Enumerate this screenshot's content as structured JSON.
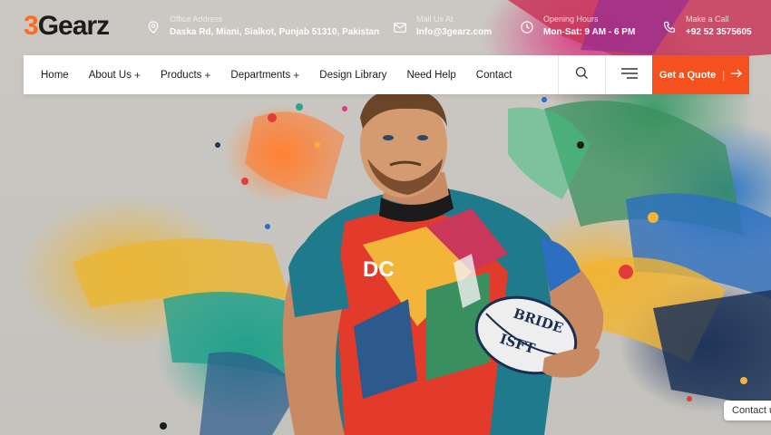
{
  "logo": {
    "num": "3",
    "text": "Gearz"
  },
  "topbar": {
    "office": {
      "label": "Office Address",
      "value": "Daska Rd, Miani, Sialkot, Punjab 51310, Pakistan",
      "icon": "map-pin-icon"
    },
    "mail": {
      "label": "Mail Us At",
      "value": "Info@3gearz.com",
      "icon": "mail-icon"
    },
    "hours": {
      "label": "Opening Hours",
      "value": "Mon-Sat: 9 AM - 6 PM",
      "icon": "clock-icon"
    },
    "call": {
      "label": "Make a Call",
      "value": "+92 52 3575605",
      "icon": "phone-icon"
    }
  },
  "nav": {
    "items": [
      {
        "label": "Home",
        "has_submenu": false
      },
      {
        "label": "About Us",
        "has_submenu": true
      },
      {
        "label": "Products",
        "has_submenu": true
      },
      {
        "label": "Departments",
        "has_submenu": true
      },
      {
        "label": "Design Library",
        "has_submenu": false
      },
      {
        "label": "Need Help",
        "has_submenu": false
      },
      {
        "label": "Contact",
        "has_submenu": false
      }
    ],
    "plus": "+",
    "quote_label": "Get a Quote",
    "quote_sep": "|"
  },
  "hero": {
    "ball_text_1": "BRIDE",
    "ball_text_2": "ISFT",
    "jersey_logo": "DC"
  },
  "contact_tab": "Contact us",
  "colors": {
    "accent": "#f4511e",
    "logo_accent": "#ff6a1f",
    "dark": "#1c1c1c"
  }
}
